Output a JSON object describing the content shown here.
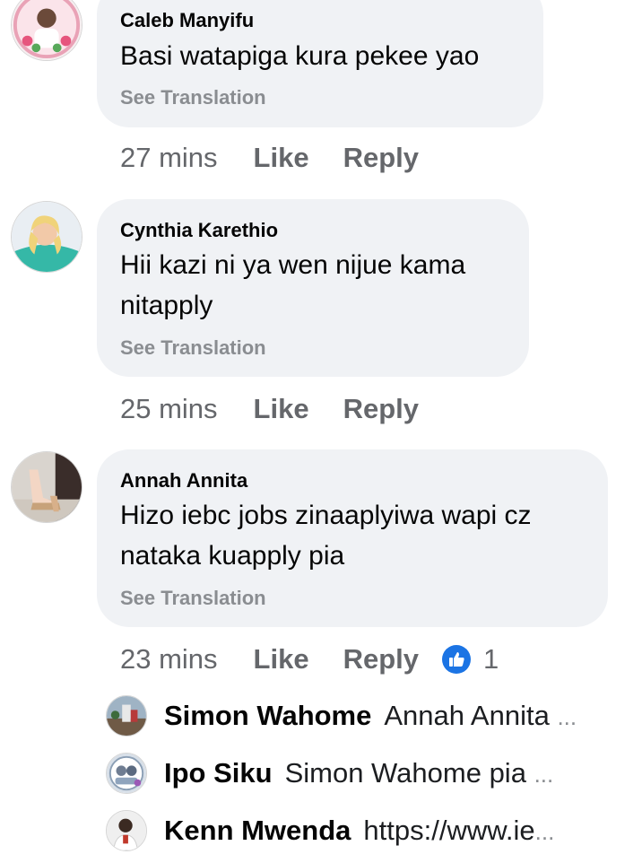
{
  "comments": [
    {
      "author": "Caleb Manyifu",
      "text": "Basi watapiga kura pekee yao",
      "see_translation": "See Translation",
      "time": "27 mins",
      "like": "Like",
      "reply": "Reply",
      "avatar_icon": "profile-photo-icon"
    },
    {
      "author": "Cynthia Karethio",
      "text": "Hii kazi ni ya wen nijue kama nitapply",
      "see_translation": "See Translation",
      "time": "25 mins",
      "like": "Like",
      "reply": "Reply",
      "avatar_icon": "profile-photo-icon"
    },
    {
      "author": "Annah Annita",
      "text": "Hizo iebc jobs zinaaplyiwa wapi cz nataka kuapply pia",
      "see_translation": "See Translation",
      "time": "23 mins",
      "like": "Like",
      "reply": "Reply",
      "reaction_count": "1",
      "reaction_icon": "thumbs-up-icon",
      "avatar_icon": "profile-photo-icon"
    }
  ],
  "replies": [
    {
      "author": "Simon Wahome",
      "snippet": "Annah Annita",
      "ellipsis": "..."
    },
    {
      "author": "Ipo Siku",
      "snippet": "Simon Wahome pia",
      "ellipsis": "..."
    },
    {
      "author": "Kenn Mwenda",
      "snippet": "https://www.ie",
      "ellipsis": "..."
    }
  ],
  "colors": {
    "bubble": "#f0f2f5",
    "secondary_text": "#65676b",
    "see_translation": "#8a8d91",
    "like_blue": "#1b74e4"
  }
}
